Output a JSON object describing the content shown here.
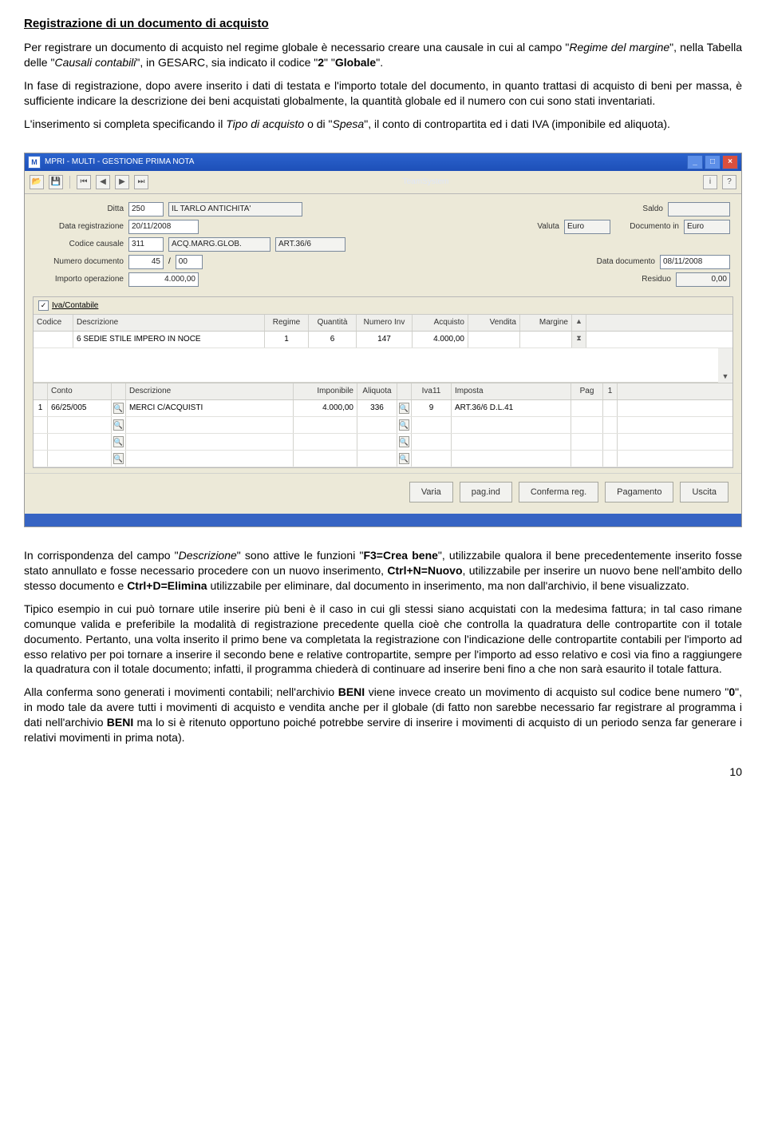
{
  "doc": {
    "title": "Registrazione di un documento di acquisto",
    "para1_a": "Per registrare un documento di acquisto nel regime globale è necessario creare una causale in cui al campo \"",
    "para1_i1": "Regime del margine",
    "para1_b": "\", nella Tabella delle \"",
    "para1_i2": "Causali contabili",
    "para1_c": "\", in GESARC, sia indicato il codice \"",
    "para1_bold1": "2",
    "para1_d": "\" \"",
    "para1_bold2": "Globale",
    "para1_e": "\".",
    "para2": "In fase di registrazione, dopo avere inserito i dati di testata e l'importo totale del documento, in quanto trattasi di acquisto di beni per massa, è sufficiente indicare la descrizione dei beni acquistati globalmente, la quantità globale ed il numero con cui sono stati inventariati.",
    "para3_a": "L'inserimento si completa specificando il ",
    "para3_i1": "Tipo di acquisto",
    "para3_b": " o di \"",
    "para3_i2": "Spesa",
    "para3_c": "\", il conto di contropartita ed i dati IVA (imponibile ed aliquota).",
    "para4_a": "In corrispondenza del campo \"",
    "para4_i1": "Descrizione",
    "para4_b": "\" sono attive le funzioni \"",
    "para4_bold1": "F3=Crea bene",
    "para4_c": "\", utilizzabile qualora il bene precedentemente inserito fosse stato annullato e fosse necessario procedere con un nuovo inserimento, ",
    "para4_bold2": "Ctrl+N=Nuovo",
    "para4_d": ", utilizzabile per inserire un nuovo bene nell'ambito dello stesso documento e ",
    "para4_bold3": "Ctrl+D=Elimina",
    "para4_e": " utilizzabile per eliminare, dal documento in inserimento, ma non dall'archivio, il bene visualizzato.",
    "para5": "Tipico esempio in cui può tornare utile inserire più beni è il caso in cui gli stessi siano acquistati con la medesima fattura; in tal caso rimane comunque valida e preferibile la modalità di registrazione precedente quella cioè che controlla la quadratura delle contropartite con il totale documento. Pertanto, una volta inserito il primo bene va completata la registrazione con l'indicazione delle contropartite contabili per l'importo ad esso relativo per poi tornare a inserire il secondo bene e relative contropartite, sempre per l'importo ad esso relativo e così via fino a raggiungere la quadratura con il totale documento; infatti, il programma chiederà di continuare ad inserire beni fino a che non sarà esaurito il totale fattura.",
    "para6_a": "Alla conferma sono generati i movimenti contabili; nell'archivio ",
    "para6_bold1": "BENI",
    "para6_b": " viene invece creato un movimento di acquisto sul codice bene numero \"",
    "para6_bold2": "0",
    "para6_c": "\", in modo tale da avere tutti i movimenti di acquisto e vendita anche per il globale (di fatto non sarebbe necessario far registrare al programma i dati nell'archivio ",
    "para6_bold3": "BENI",
    "para6_d": " ma lo si è ritenuto opportuno poiché potrebbe servire di inserire i movimenti di acquisto di un periodo senza far generare i relativi movimenti in prima nota).",
    "page_number": "10"
  },
  "app": {
    "title": "MPRI  -  MULTI  -  GESTIONE PRIMA NOTA",
    "brand": "TeamSystem",
    "labels": {
      "ditta": "Ditta",
      "data_reg": "Data registrazione",
      "codice_causale": "Codice causale",
      "num_doc": "Numero documento",
      "imp_op": "Importo operazione",
      "saldo": "Saldo",
      "valuta": "Valuta",
      "doc_in": "Documento in",
      "data_doc": "Data documento",
      "residuo": "Residuo",
      "iva_contabile": "Iva/Contabile"
    },
    "values": {
      "ditta": "250",
      "ditta_desc": "IL TARLO ANTICHITA'",
      "data_reg": "20/11/2008",
      "causale_code": "311",
      "causale_desc": "ACQ.MARG.GLOB.",
      "causale_art": "ART.36/6",
      "num_doc_a": "45",
      "num_doc_b": "00",
      "imp_op": "4.000,00",
      "valuta": "Euro",
      "doc_in": "Euro",
      "data_doc": "08/11/2008",
      "residuo": "0,00"
    },
    "grid1": {
      "headers": [
        "Codice",
        "Descrizione",
        "Regime",
        "Quantità",
        "Numero Inv",
        "Acquisto",
        "Vendita",
        "Margine"
      ],
      "row": {
        "codice": "",
        "descr": "6 SEDIE STILE IMPERO IN NOCE",
        "regime": "1",
        "qta": "6",
        "numinv": "147",
        "acquisto": "4.000,00",
        "vendita": "",
        "margine": ""
      }
    },
    "grid2": {
      "headers": {
        "conto": "Conto",
        "descr": "Descrizione",
        "imponibile": "Imponibile",
        "aliquota": "Aliquota",
        "iva11": "Iva11",
        "imposta": "Imposta",
        "pag": "Pag",
        "pagval": "1"
      },
      "row": {
        "idx": "1",
        "conto": "66/25/005",
        "descr": "MERCI C/ACQUISTI",
        "imponibile": "4.000,00",
        "aliquota": "336",
        "iva11": "9",
        "imposta": "ART.36/6 D.L.41"
      }
    },
    "buttons": {
      "varia": "Varia",
      "pagind": "pag.ind",
      "conferma": "Conferma reg.",
      "pagamento": "Pagamento",
      "uscita": "Uscita"
    }
  }
}
